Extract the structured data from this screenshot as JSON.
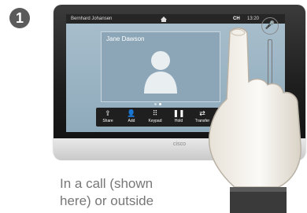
{
  "step": "1",
  "screen": {
    "caller": "Bernhard Johansen",
    "clock": "13:20",
    "active_icon": "CH",
    "pip_name": "Jane Dawson"
  },
  "tray": [
    {
      "label": "Share",
      "icon": "share-icon"
    },
    {
      "label": "Add",
      "icon": "add-participant-icon"
    },
    {
      "label": "Keypad",
      "icon": "keypad-icon"
    },
    {
      "label": "Hold",
      "icon": "hold-icon"
    },
    {
      "label": "Transfer",
      "icon": "transfer-icon"
    }
  ],
  "end_call": {
    "icon": "end-call-icon",
    "color": "#d42a2a"
  },
  "logo": "cisco",
  "caption": {
    "line1": "In a call (shown",
    "line2": "here) or outside"
  }
}
